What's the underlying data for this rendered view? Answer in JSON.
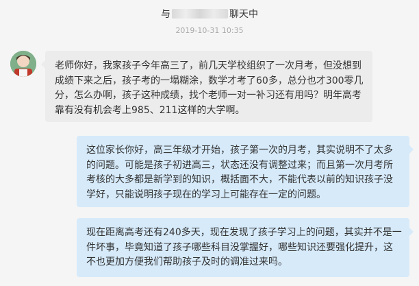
{
  "header": {
    "prefix": "与",
    "suffix": "聊天中"
  },
  "timestamp": "2019-10-31 10:35",
  "messages": [
    {
      "sender": "parent",
      "lines": [
        "老师你好，我家孩子今年高三了，前几天学校组织了一次月考，但没想到",
        "成绩下来之后，孩子考的一塌糊涂，数学才考了60多，总分也才300零几",
        "分，怎么办啊，孩子这种成绩，找个老师一对一补习还有用吗？明年高考",
        "靠有没有机会考上985、211这样的大学啊。"
      ]
    },
    {
      "sender": "teacher",
      "lines": [
        "这位家长你好，高三年级才开始，孩子第一次的月考，其实说明不了太多",
        "的问题。可能是孩子初进高三，状态还没有调整过来；而且第一次月考所",
        "考核的大多都是新学到的知识，概括面不大，不能代表以前的知识孩子没",
        "学好，只能说明孩子现在的学习上可能存在一定的问题。"
      ]
    },
    {
      "sender": "teacher",
      "lines": [
        "现在距离高考还有240多天，现在发现了孩子学习上的问题，其实并不是一",
        "件坏事，毕竟知道了孩子哪些科目没掌握好，哪些知识还要强化提升，这",
        "不也更加方便我们帮助孩子及时的调准过来吗。"
      ]
    }
  ]
}
